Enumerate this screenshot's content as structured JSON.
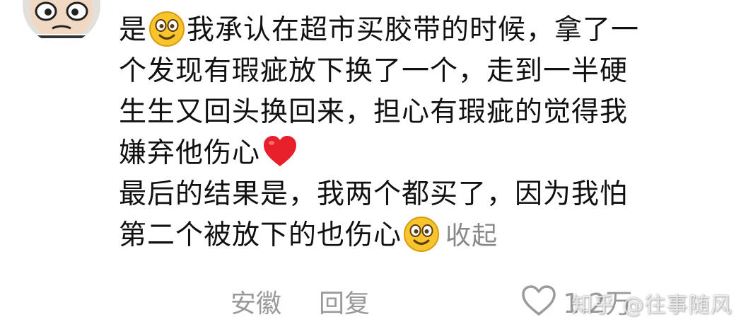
{
  "comment": {
    "lines": [
      {
        "pre": "是",
        "emoji": "smile-emoji",
        "post": "我承认在超市买胶带的时候，拿了一"
      },
      {
        "text": "个发现有瑕疵放下换了一个，走到一半硬"
      },
      {
        "text": "生生又回头换回来，担心有瑕疵的觉得我"
      },
      {
        "pre": "嫌弃他伤心",
        "emoji": "red-heart-emoji"
      },
      {
        "text": "最后的结果是，我两个都买了，因为我怕"
      },
      {
        "pre": "第二个被放下的也伤心",
        "emoji": "smile-emoji",
        "collapse": "收起"
      }
    ]
  },
  "meta": {
    "location": "安徽",
    "reply": "回复",
    "like_icon": "heart-outline-icon",
    "like_count": "1.2万"
  },
  "watermark": "知乎 @往事随风",
  "colors": {
    "text": "#111111",
    "muted": "#9a9a9a",
    "heart": "#e8202c",
    "emoji_face": "#f7c52b"
  }
}
